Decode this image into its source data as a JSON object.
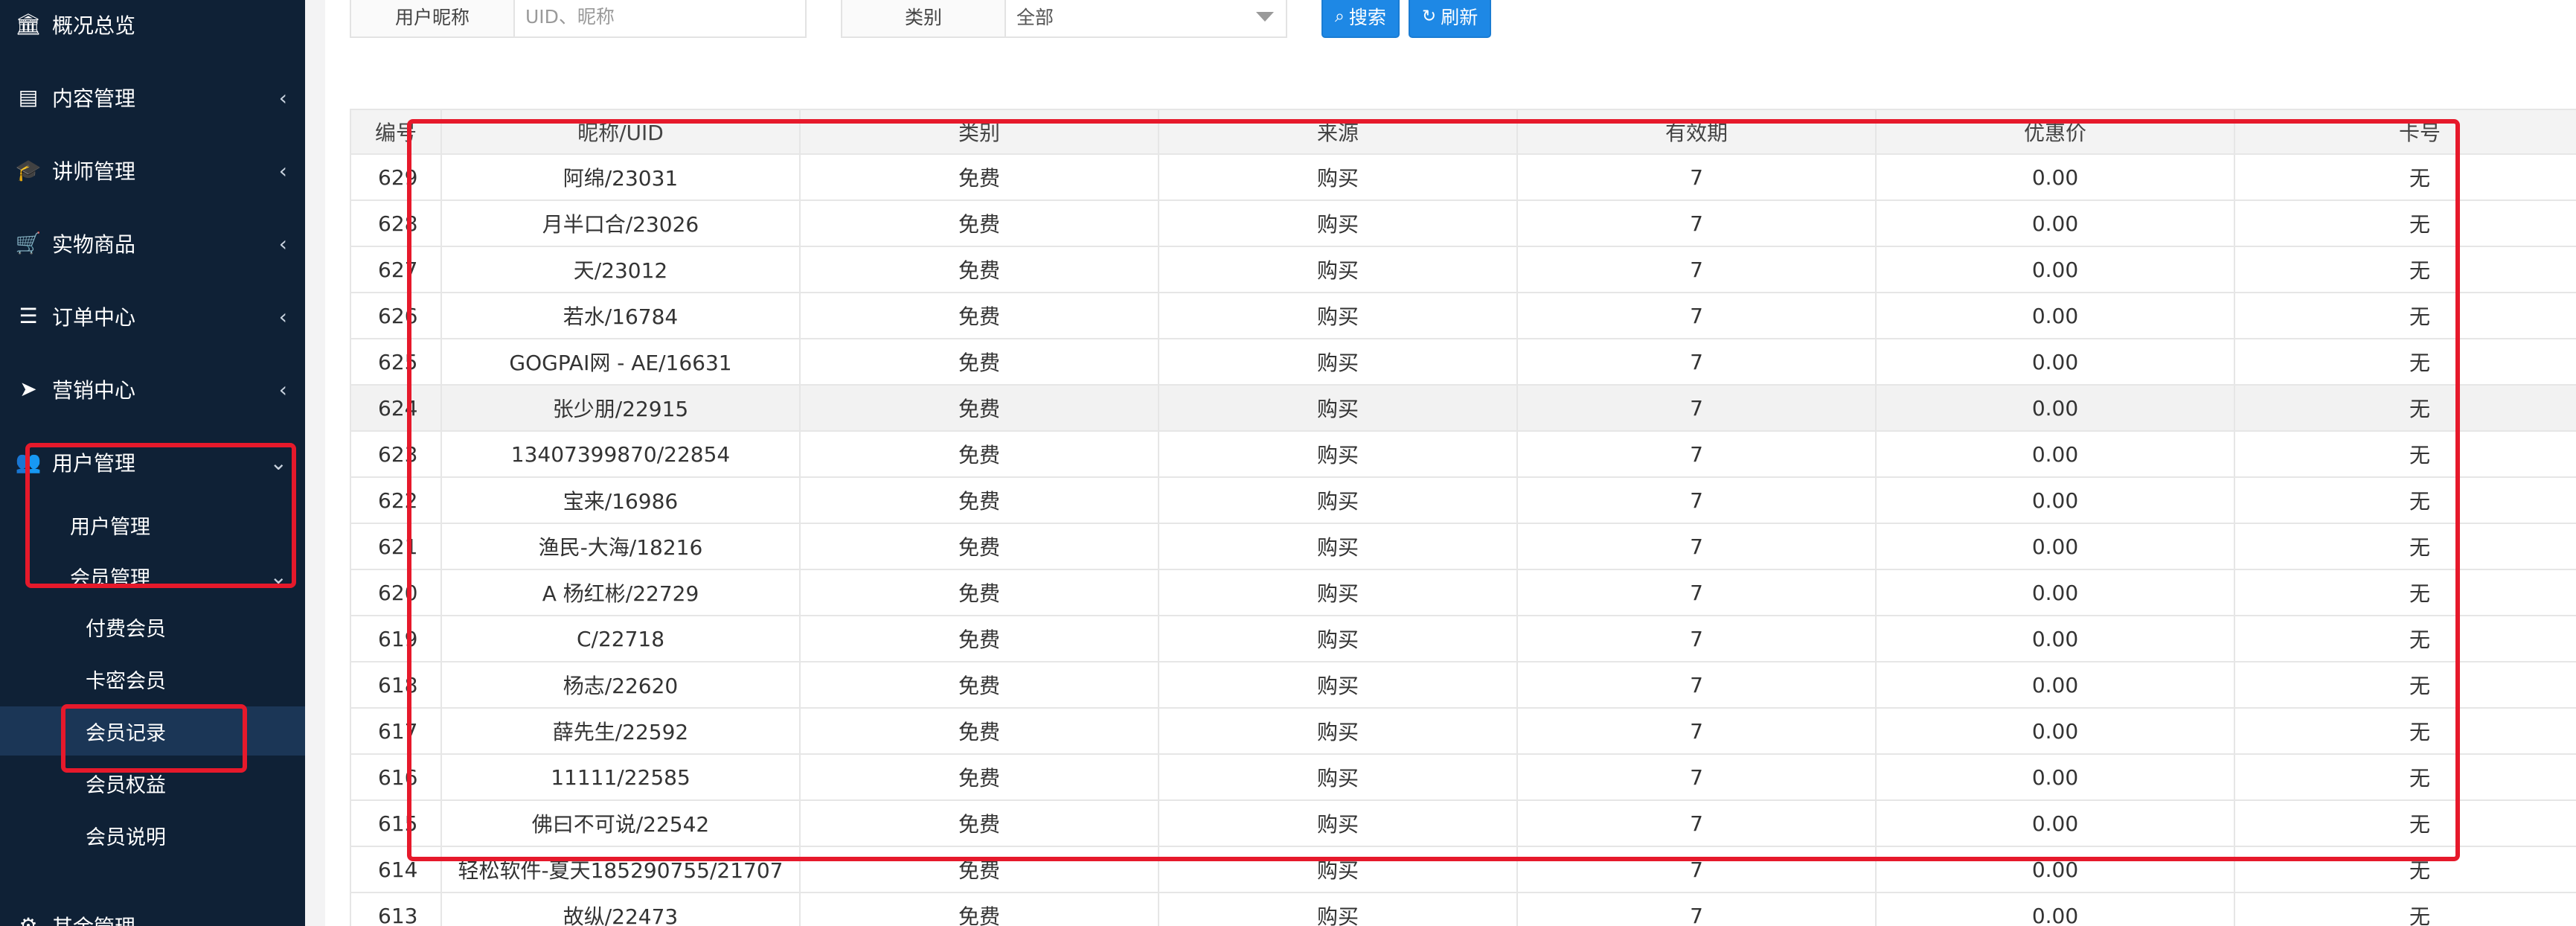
{
  "sidebar": {
    "top_items": [
      {
        "label": "概况总览",
        "icon": "bank-icon",
        "glyph": "🏛",
        "has_chevron": false
      },
      {
        "label": "内容管理",
        "icon": "newspaper-icon",
        "glyph": "▤",
        "has_chevron": true,
        "chevron": "‹"
      },
      {
        "label": "讲师管理",
        "icon": "graduation-cap-icon",
        "glyph": "🎓",
        "has_chevron": true,
        "chevron": "‹"
      },
      {
        "label": "实物商品",
        "icon": "cart-icon",
        "glyph": "🛒",
        "has_chevron": true,
        "chevron": "‹"
      },
      {
        "label": "订单中心",
        "icon": "list-icon",
        "glyph": "☰",
        "has_chevron": true,
        "chevron": "‹"
      },
      {
        "label": "营销中心",
        "icon": "paper-plane-icon",
        "glyph": "➤",
        "has_chevron": true,
        "chevron": "‹"
      }
    ],
    "user_management": {
      "label": "用户管理",
      "icon": "users-icon",
      "glyph": "👥",
      "chevron": "⌄",
      "children": [
        {
          "label": "用户管理"
        },
        {
          "label": "会员管理",
          "chevron": "⌄"
        }
      ]
    },
    "member_children": [
      {
        "label": "付费会员",
        "active": false
      },
      {
        "label": "卡密会员",
        "active": false
      },
      {
        "label": "会员记录",
        "active": true
      },
      {
        "label": "会员权益",
        "active": false
      },
      {
        "label": "会员说明",
        "active": false
      }
    ],
    "bottom_item": {
      "label": "其余管理",
      "icon": "gear-icon",
      "glyph": "⚙"
    }
  },
  "filters": {
    "nickname_label": "用户昵称",
    "nickname_placeholder": "UID、昵称",
    "nickname_value": "",
    "type_label": "类别",
    "type_value": "全部",
    "search_button": "搜索",
    "search_icon": "magnifier-icon",
    "refresh_button": "刷新",
    "refresh_icon": "refresh-icon"
  },
  "table": {
    "columns": [
      "编号",
      "昵称/UID",
      "类别",
      "来源",
      "有效期",
      "优惠价",
      "卡号"
    ],
    "rows": [
      {
        "id": "629",
        "nickname": "阿绵/23031",
        "type": "免费",
        "source": "购买",
        "validity": "7",
        "price": "0.00",
        "card": "无"
      },
      {
        "id": "628",
        "nickname": "月半口合/23026",
        "type": "免费",
        "source": "购买",
        "validity": "7",
        "price": "0.00",
        "card": "无"
      },
      {
        "id": "627",
        "nickname": "天/23012",
        "type": "免费",
        "source": "购买",
        "validity": "7",
        "price": "0.00",
        "card": "无"
      },
      {
        "id": "626",
        "nickname": "若水/16784",
        "type": "免费",
        "source": "购买",
        "validity": "7",
        "price": "0.00",
        "card": "无"
      },
      {
        "id": "625",
        "nickname": "GOGPAI网 - AE/16631",
        "type": "免费",
        "source": "购买",
        "validity": "7",
        "price": "0.00",
        "card": "无"
      },
      {
        "id": "624",
        "nickname": "张少朋/22915",
        "type": "免费",
        "source": "购买",
        "validity": "7",
        "price": "0.00",
        "card": "无",
        "hover": true
      },
      {
        "id": "623",
        "nickname": "13407399870/22854",
        "type": "免费",
        "source": "购买",
        "validity": "7",
        "price": "0.00",
        "card": "无"
      },
      {
        "id": "622",
        "nickname": "宝来/16986",
        "type": "免费",
        "source": "购买",
        "validity": "7",
        "price": "0.00",
        "card": "无"
      },
      {
        "id": "621",
        "nickname": "渔民-大海/18216",
        "type": "免费",
        "source": "购买",
        "validity": "7",
        "price": "0.00",
        "card": "无"
      },
      {
        "id": "620",
        "nickname": "A 杨红彬/22729",
        "type": "免费",
        "source": "购买",
        "validity": "7",
        "price": "0.00",
        "card": "无"
      },
      {
        "id": "619",
        "nickname": "C/22718",
        "type": "免费",
        "source": "购买",
        "validity": "7",
        "price": "0.00",
        "card": "无"
      },
      {
        "id": "618",
        "nickname": "杨志/22620",
        "type": "免费",
        "source": "购买",
        "validity": "7",
        "price": "0.00",
        "card": "无"
      },
      {
        "id": "617",
        "nickname": "薛先生/22592",
        "type": "免费",
        "source": "购买",
        "validity": "7",
        "price": "0.00",
        "card": "无"
      },
      {
        "id": "616",
        "nickname": "11111/22585",
        "type": "免费",
        "source": "购买",
        "validity": "7",
        "price": "0.00",
        "card": "无"
      },
      {
        "id": "615",
        "nickname": "佛曰不可说/22542",
        "type": "免费",
        "source": "购买",
        "validity": "7",
        "price": "0.00",
        "card": "无"
      },
      {
        "id": "614",
        "nickname": "轻松软件-夏天185290755/21707",
        "type": "免费",
        "source": "购买",
        "validity": "7",
        "price": "0.00",
        "card": "无"
      },
      {
        "id": "613",
        "nickname": "故纵/22473",
        "type": "免费",
        "source": "购买",
        "validity": "7",
        "price": "0.00",
        "card": "无"
      }
    ]
  },
  "colors": {
    "sidebar_bg": "#0f2136",
    "sidebar_active": "#1b3656",
    "primary_button": "#1e88e5",
    "annotation_red": "#e6192b"
  }
}
